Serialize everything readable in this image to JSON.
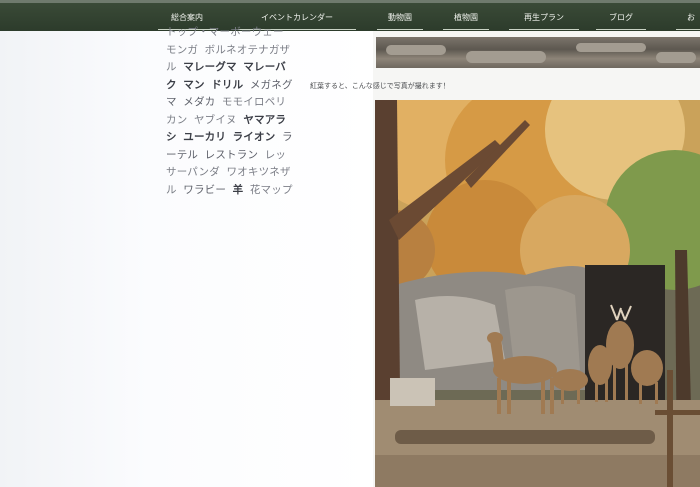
{
  "nav": {
    "items": [
      "総合案内",
      "イベントカレンダー",
      "動物園",
      "植物園",
      "再生プラン",
      "ブログ",
      "お"
    ]
  },
  "tags": [
    {
      "text": "トップ・マーボーウェー",
      "weight": "light"
    },
    {
      "text": "モンガ",
      "weight": "light"
    },
    {
      "text": "ボルネオテナガザル",
      "weight": "light"
    },
    {
      "text": "マレーグマ",
      "weight": "bold"
    },
    {
      "text": "マレーバク",
      "weight": "bold"
    },
    {
      "text": "マン",
      "weight": "bold"
    },
    {
      "text": "ドリル",
      "weight": "bold"
    },
    {
      "text": "メガネグマ",
      "weight": "medium"
    },
    {
      "text": "メダカ",
      "weight": "medium"
    },
    {
      "text": "モモイロペリカン",
      "weight": "light"
    },
    {
      "text": "ヤブイヌ",
      "weight": "light"
    },
    {
      "text": "ヤマアラシ",
      "weight": "bold"
    },
    {
      "text": "ユーカリ",
      "weight": "bold"
    },
    {
      "text": "ライオン",
      "weight": "bold"
    },
    {
      "text": "ラーテル",
      "weight": "medium"
    },
    {
      "text": "レストラン",
      "weight": "medium"
    },
    {
      "text": "レッサーパンダ",
      "weight": "light"
    },
    {
      "text": "ワオキツネザル",
      "weight": "light"
    },
    {
      "text": "ワラビー",
      "weight": "medium"
    },
    {
      "text": "羊",
      "weight": "bold"
    },
    {
      "text": "花マップ",
      "weight": "light"
    }
  ],
  "post": {
    "caption": "紅葉すると、こんな感じで写真が撮れます！"
  },
  "colors": {
    "nav_bg": "#2f3e2e",
    "nav_text": "#f2f4ef",
    "tag_bold": "#3b3e46",
    "tag_light": "#7b7e86"
  }
}
